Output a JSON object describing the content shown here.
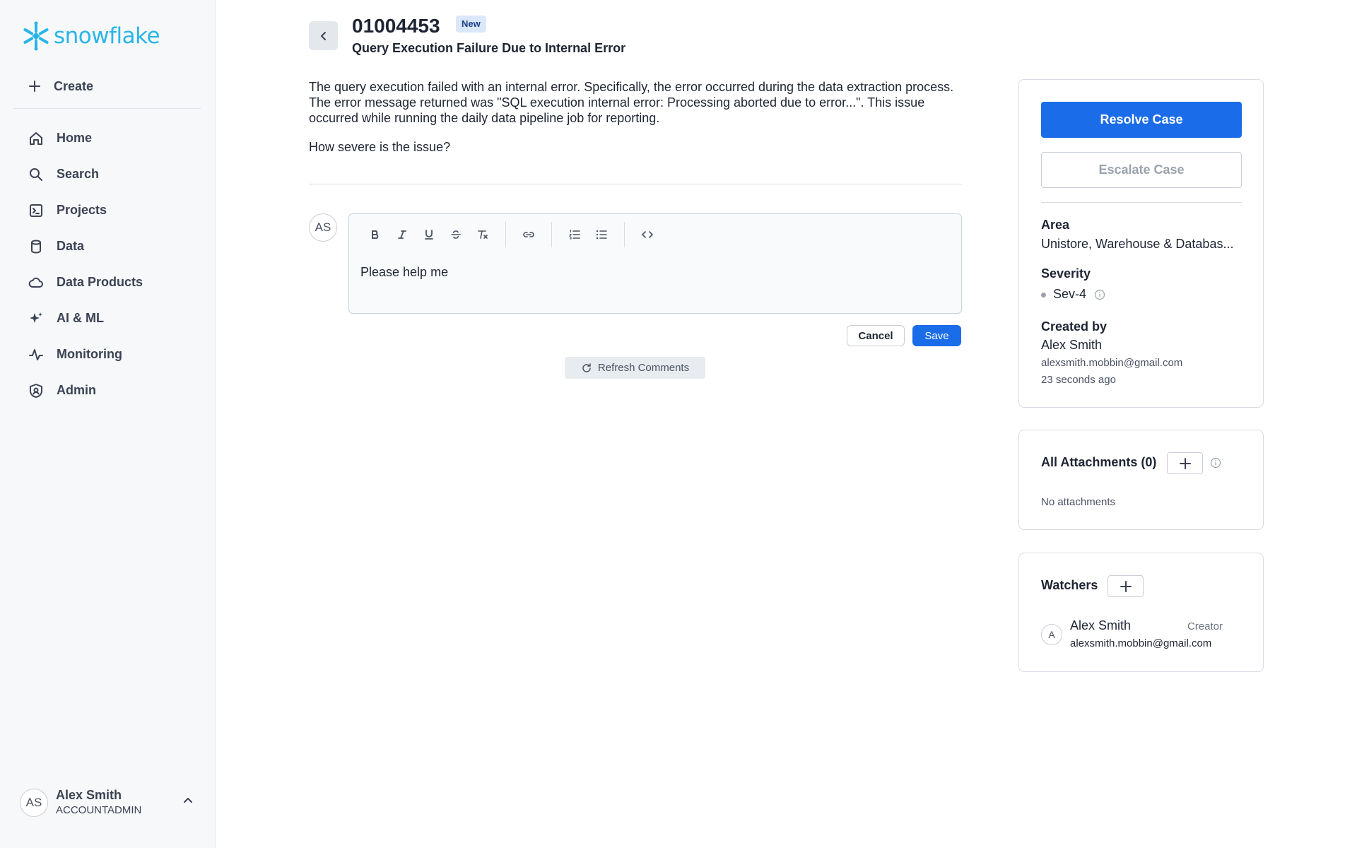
{
  "brand": {
    "name": "snowflake",
    "color": "#29b5e8"
  },
  "sidebar": {
    "create_label": "Create",
    "items": [
      {
        "label": "Home",
        "icon": "home-icon"
      },
      {
        "label": "Search",
        "icon": "search-icon"
      },
      {
        "label": "Projects",
        "icon": "projects-icon"
      },
      {
        "label": "Data",
        "icon": "database-icon"
      },
      {
        "label": "Data Products",
        "icon": "cloud-icon"
      },
      {
        "label": "AI & ML",
        "icon": "sparkle-icon"
      },
      {
        "label": "Monitoring",
        "icon": "activity-icon"
      },
      {
        "label": "Admin",
        "icon": "shield-icon"
      }
    ],
    "user": {
      "initials": "AS",
      "name": "Alex Smith",
      "role": "ACCOUNTADMIN"
    }
  },
  "case": {
    "id": "01004453",
    "status_badge": "New",
    "title": "Query Execution Failure Due to Internal Error",
    "description": "The query execution failed with an internal error. Specifically, the error occurred during the data extraction process. The error message returned was \"SQL execution internal error: Processing aborted due to error...\". This issue occurred while running the daily data pipeline job for reporting.",
    "question": "How severe is the issue?"
  },
  "comment": {
    "avatar_initials": "AS",
    "text": "Please help me",
    "cancel_label": "Cancel",
    "save_label": "Save",
    "refresh_label": "Refresh Comments"
  },
  "details": {
    "resolve_label": "Resolve Case",
    "escalate_label": "Escalate Case",
    "area_label": "Area",
    "area_value": "Unistore, Warehouse & Databas...",
    "severity_label": "Severity",
    "severity_value": "Sev-4",
    "created_by_label": "Created by",
    "created_by_name": "Alex Smith",
    "created_by_email": "alexsmith.mobbin@gmail.com",
    "created_ago": "23 seconds ago"
  },
  "attachments": {
    "title": "All Attachments (0)",
    "empty_text": "No attachments"
  },
  "watchers": {
    "title": "Watchers",
    "items": [
      {
        "initial": "A",
        "name": "Alex Smith",
        "role": "Creator",
        "email": "alexsmith.mobbin@gmail.com"
      }
    ]
  },
  "colors": {
    "primary": "#1a6ce8",
    "badge_bg": "#dbe7fb"
  }
}
